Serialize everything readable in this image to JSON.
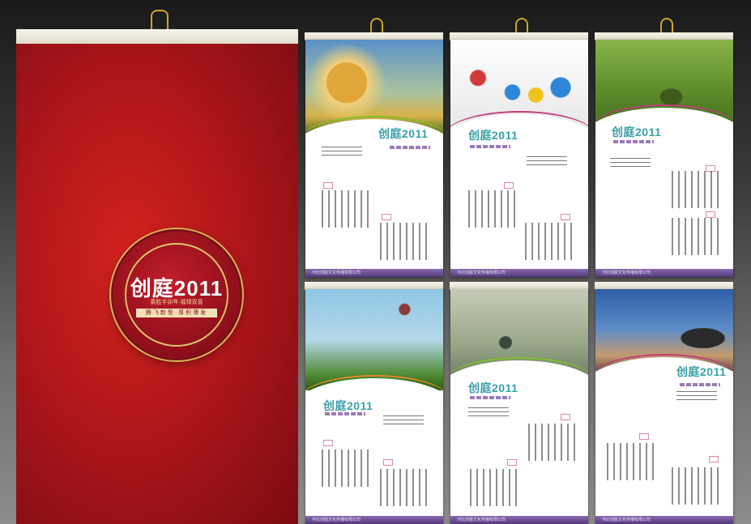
{
  "cover": {
    "logo": "创庭2011",
    "subtitle": "乘胜半卯年·福禄双喜",
    "tagline": "腾飞新型·厚积薄发"
  },
  "sheets": [
    {
      "name": "dandelion",
      "logo": "创庭2011",
      "footer": "河北创庭文化传播有限公司"
    },
    {
      "name": "butterflies",
      "logo": "创庭2011",
      "footer": "河北创庭文化传播有限公司"
    },
    {
      "name": "tree",
      "logo": "创庭2011",
      "footer": "河北创庭文化传播有限公司"
    },
    {
      "name": "thistle",
      "logo": "创庭2011",
      "footer": "河北创庭文化传播有限公司"
    },
    {
      "name": "seeds",
      "logo": "创庭2011",
      "footer": "河北创庭文化传播有限公司"
    },
    {
      "name": "sunset",
      "logo": "创庭2011",
      "footer": "河北创庭文化传播有限公司"
    }
  ],
  "colors": {
    "accent": "#3aa0a8",
    "cover": "#b0161b",
    "purple": "#6a4a96"
  }
}
